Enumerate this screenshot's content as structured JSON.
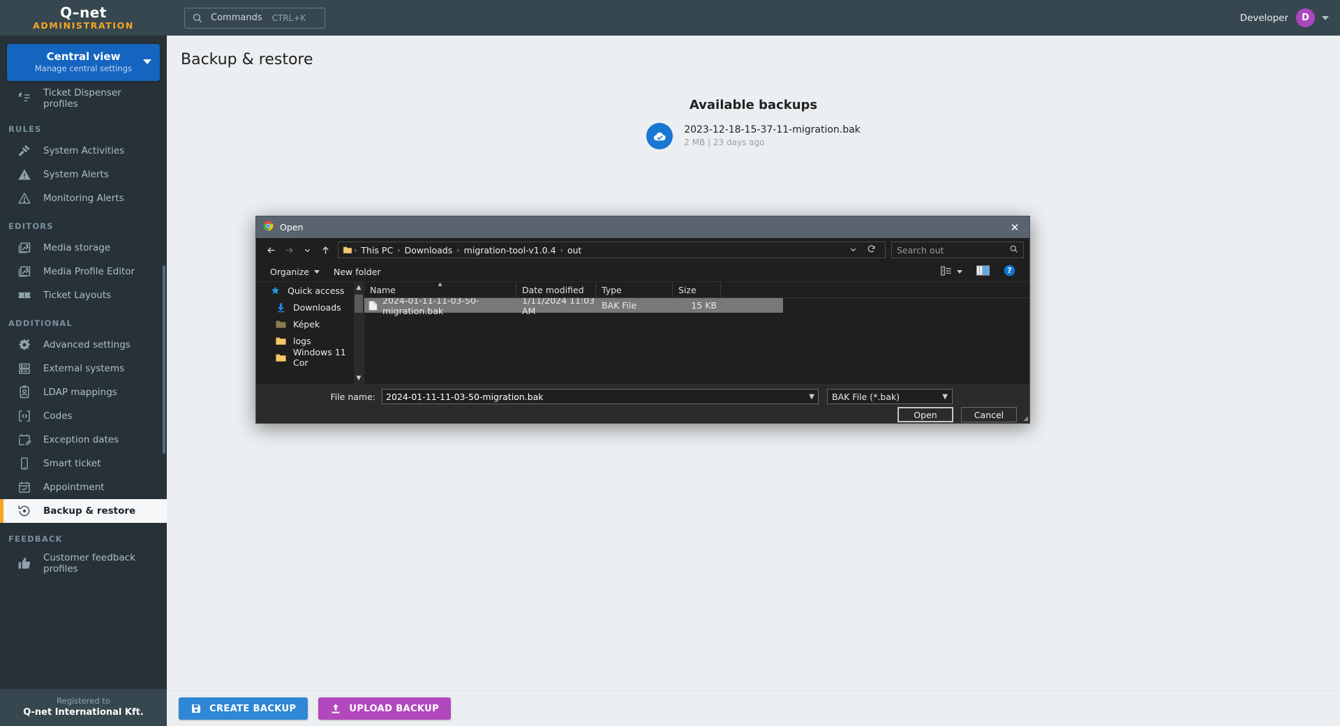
{
  "brand": {
    "logo": "Q–net",
    "subtitle": "ADMINISTRATION"
  },
  "topbar": {
    "command_label": "Commands",
    "command_shortcut": "CTRL+K",
    "user_name": "Developer",
    "avatar_initial": "D"
  },
  "sidebar": {
    "central_view": {
      "title": "Central view",
      "subtitle": "Manage central settings"
    },
    "items": [
      {
        "label": "Ticket Dispenser profiles",
        "icon": "ticket-dispenser-icon",
        "type": "item"
      },
      {
        "label": "RULES",
        "type": "section"
      },
      {
        "label": "System Activities",
        "icon": "gavel-icon",
        "type": "item"
      },
      {
        "label": "System Alerts",
        "icon": "warning-filled-icon",
        "type": "item"
      },
      {
        "label": "Monitoring Alerts",
        "icon": "warning-outline-icon",
        "type": "item"
      },
      {
        "label": "EDITORS",
        "type": "section"
      },
      {
        "label": "Media storage",
        "icon": "image-stack-icon",
        "type": "item"
      },
      {
        "label": "Media Profile Editor",
        "icon": "image-stack-icon",
        "type": "item"
      },
      {
        "label": "Ticket Layouts",
        "icon": "ticket-icon",
        "type": "item"
      },
      {
        "label": "ADDITIONAL",
        "type": "section"
      },
      {
        "label": "Advanced settings",
        "icon": "gear-sparkle-icon",
        "type": "item"
      },
      {
        "label": "External systems",
        "icon": "server-icon",
        "type": "item"
      },
      {
        "label": "LDAP mappings",
        "icon": "id-badge-icon",
        "type": "item"
      },
      {
        "label": "Codes",
        "icon": "code-brackets-icon",
        "type": "item"
      },
      {
        "label": "Exception dates",
        "icon": "calendar-edit-icon",
        "type": "item"
      },
      {
        "label": "Smart ticket",
        "icon": "phone-icon",
        "type": "item"
      },
      {
        "label": "Appointment",
        "icon": "calendar-check-icon",
        "type": "item"
      },
      {
        "label": "Backup & restore",
        "icon": "restore-icon",
        "type": "item",
        "active": true
      },
      {
        "label": "FEEDBACK",
        "type": "section"
      },
      {
        "label": "Customer feedback profiles",
        "icon": "thumbs-up-icon",
        "type": "item"
      }
    ],
    "registered": {
      "line1": "Registered to",
      "line2": "Q-net International Kft."
    }
  },
  "main": {
    "page_title": "Backup & restore",
    "backups_heading": "Available backups",
    "backups": [
      {
        "name": "2023-12-18-15-37-11-migration.bak",
        "meta": "2 MB | 23 days ago"
      }
    ],
    "create_backup_label": "CREATE BACKUP",
    "upload_backup_label": "UPLOAD BACKUP"
  },
  "colors": {
    "sidebar_bg": "#263238",
    "accent_blue": "#1565c0",
    "accent_orange": "#f5a623",
    "create_btn": "#2f87d5",
    "upload_btn": "#b348be",
    "avatar": "#ab47bc"
  },
  "open_dialog": {
    "title": "Open",
    "breadcrumb": [
      "This PC",
      "Downloads",
      "migration-tool-v1.0.4",
      "out"
    ],
    "search_placeholder": "Search out",
    "toolbar": {
      "organize": "Organize",
      "new_folder": "New folder"
    },
    "tree": [
      {
        "label": "Quick access",
        "icon": "star-icon",
        "indent": false
      },
      {
        "label": "Downloads",
        "icon": "download-arrow-icon",
        "indent": true
      },
      {
        "label": "Képek",
        "icon": "folder-icon",
        "indent": true
      },
      {
        "label": "logs",
        "icon": "folder-icon",
        "indent": true
      },
      {
        "label": "Windows 11 Cor",
        "icon": "folder-icon",
        "indent": true
      }
    ],
    "columns": [
      "Name",
      "Date modified",
      "Type",
      "Size"
    ],
    "sorted_column": "Name",
    "files": [
      {
        "name": "2024-01-11-11-03-50-migration.bak",
        "date_modified": "1/11/2024 11:03 AM",
        "type": "BAK File",
        "size": "15 KB",
        "selected": true
      }
    ],
    "filename_label": "File name:",
    "filename_value": "2024-01-11-11-03-50-migration.bak",
    "filetype_value": "BAK File (*.bak)",
    "open_button": "Open",
    "cancel_button": "Cancel"
  }
}
